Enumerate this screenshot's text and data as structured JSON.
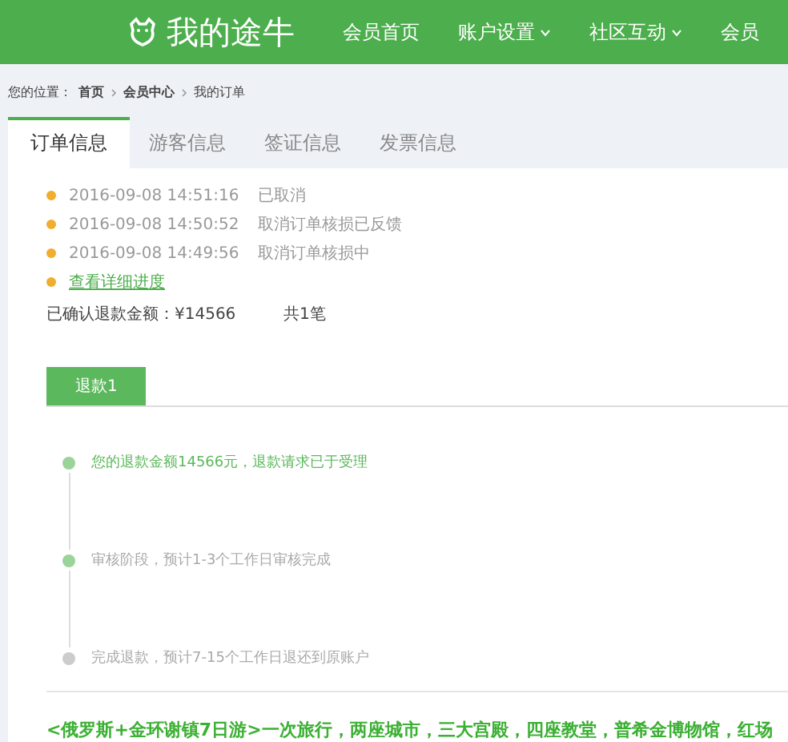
{
  "header": {
    "logo_text": "我的途牛",
    "nav": [
      {
        "label": "会员首页",
        "has_menu": false
      },
      {
        "label": "账户设置",
        "has_menu": true
      },
      {
        "label": "社区互动",
        "has_menu": true
      },
      {
        "label": "会员",
        "has_menu": false
      }
    ]
  },
  "breadcrumb": {
    "prefix": "您的位置：",
    "items": [
      "首页",
      "会员中心",
      "我的订单"
    ]
  },
  "tabs": [
    {
      "label": "订单信息",
      "selected": true
    },
    {
      "label": "游客信息",
      "selected": false
    },
    {
      "label": "签证信息",
      "selected": false
    },
    {
      "label": "发票信息",
      "selected": false
    }
  ],
  "order_log": [
    {
      "time": "2016-09-08 14:51:16",
      "status": "已取消"
    },
    {
      "time": "2016-09-08 14:50:52",
      "status": "取消订单核损已反馈"
    },
    {
      "time": "2016-09-08 14:49:56",
      "status": "取消订单核损中"
    }
  ],
  "progress_link": "查看详细进度",
  "refund_summary": {
    "amount": "已确认退款金额：¥14566",
    "count": "共1笔"
  },
  "refund_tabs": [
    {
      "label": "退款1",
      "selected": true
    }
  ],
  "refund_steps": [
    {
      "text": "您的退款金额14566元，退款请求已于受理",
      "kind": "current"
    },
    {
      "text": "审核阶段，预计1-3个工作日审核完成",
      "kind": "reached"
    },
    {
      "text": "完成退款，预计7-15个工作日退还到原账户",
      "kind": "pending"
    }
  ],
  "product_title": "<俄罗斯+金环谢镇7日游>一次旅行，两座城市，三大宫殿，四座教堂，普希金博物馆，红场"
}
